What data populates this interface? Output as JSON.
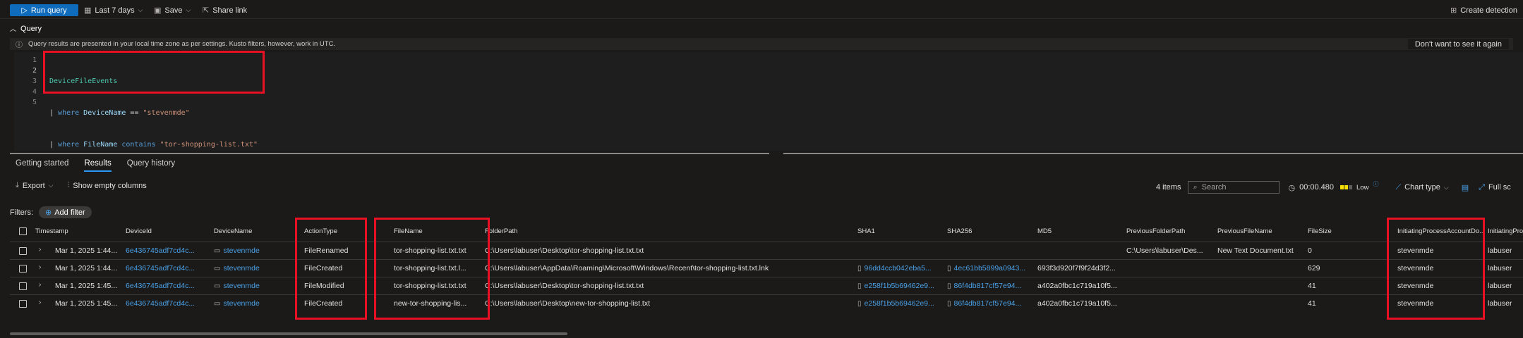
{
  "toolbar": {
    "run_query": "Run query",
    "time_range": "Last 7 days",
    "save": "Save",
    "share": "Share link",
    "create_detection": "Create detection"
  },
  "query": {
    "title": "Query",
    "info": "Query results are presented in your local time zone as per settings. Kusto filters, however, work in UTC.",
    "dismiss": "Don't want to see it again",
    "line_numbers": [
      "1",
      "2",
      "3",
      "4",
      "5"
    ],
    "lines": [
      "DeviceFileEvents",
      "| where DeviceName == \"stevenmde\"",
      "| where FileName contains \"tor-shopping-list.txt\""
    ]
  },
  "tabs": [
    "Getting started",
    "Results",
    "Query history"
  ],
  "results_toolbar": {
    "export": "Export",
    "show_empty": "Show empty columns",
    "items": "4 items",
    "search_placeholder": "Search",
    "duration": "00:00.480",
    "priority": "Low",
    "chart_type": "Chart type",
    "full_screen": "Full sc"
  },
  "filters": {
    "label": "Filters:",
    "add": "Add filter"
  },
  "columns": [
    "Timestamp",
    "DeviceId",
    "DeviceName",
    "ActionType",
    "FileName",
    "FolderPath",
    "SHA1",
    "SHA256",
    "MD5",
    "PreviousFolderPath",
    "PreviousFileName",
    "FileSize",
    "InitiatingProcessAccountDo...",
    "InitiatingProc"
  ],
  "rows": [
    [
      "Mar 1, 2025 1:44...",
      "6e436745adf7cd4c...",
      "stevenmde",
      "FileRenamed",
      "tor-shopping-list.txt.txt",
      "C:\\Users\\labuser\\Desktop\\tor-shopping-list.txt.txt",
      "",
      "",
      "",
      "C:\\Users\\labuser\\Des...",
      "New Text Document.txt",
      "0",
      "stevenmde",
      "labuser"
    ],
    [
      "Mar 1, 2025 1:44...",
      "6e436745adf7cd4c...",
      "stevenmde",
      "FileCreated",
      "tor-shopping-list.txt.l...",
      "C:\\Users\\labuser\\AppData\\Roaming\\Microsoft\\Windows\\Recent\\tor-shopping-list.txt.lnk",
      "96dd4ccb042eba5...",
      "4ec61bb5899a0943...",
      "693f3d920f7f9f24d3f2...",
      "",
      "",
      "629",
      "stevenmde",
      "labuser"
    ],
    [
      "Mar 1, 2025 1:45...",
      "6e436745adf7cd4c...",
      "stevenmde",
      "FileModified",
      "tor-shopping-list.txt.txt",
      "C:\\Users\\labuser\\Desktop\\tor-shopping-list.txt.txt",
      "e258f1b5b69462e9...",
      "86f4db817cf57e94...",
      "a402a0fbc1c719a10f5...",
      "",
      "",
      "41",
      "stevenmde",
      "labuser"
    ],
    [
      "Mar 1, 2025 1:45...",
      "6e436745adf7cd4c...",
      "stevenmde",
      "FileCreated",
      "new-tor-shopping-lis...",
      "C:\\Users\\labuser\\Desktop\\new-tor-shopping-list.txt",
      "e258f1b5b69462e9...",
      "86f4db817cf57e94...",
      "a402a0fbc1c719a10f5...",
      "",
      "",
      "41",
      "stevenmde",
      "labuser"
    ]
  ],
  "colors": {
    "accent": "#0f6cbd",
    "link": "#4aa0e6",
    "highlight": "#e81123"
  }
}
